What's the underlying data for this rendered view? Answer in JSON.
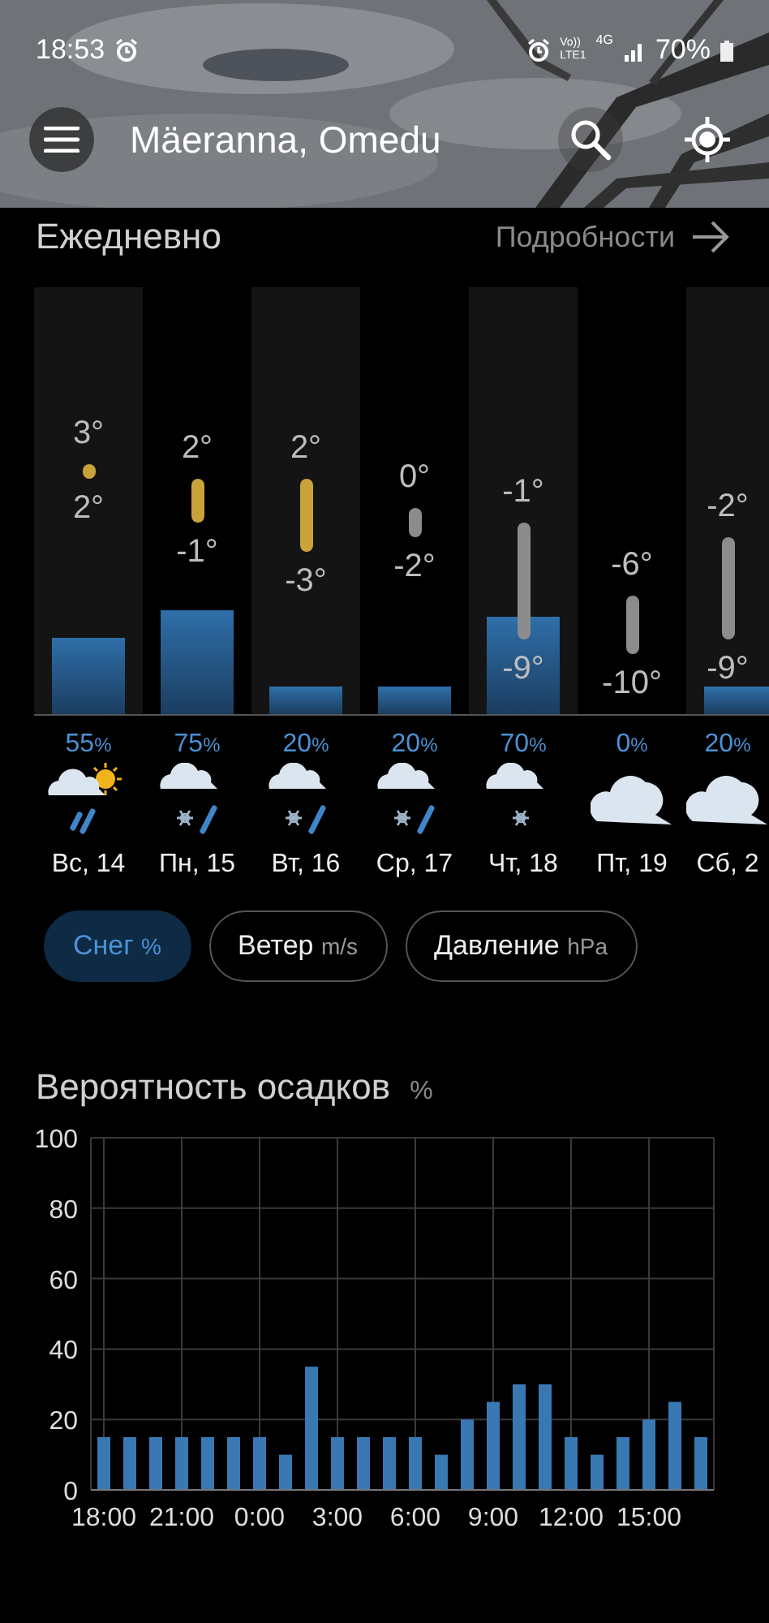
{
  "status_bar": {
    "time": "18:53",
    "volte_top": "Vo))",
    "volte_bottom": "LTE1",
    "network": "4G",
    "battery": "70%"
  },
  "header": {
    "location": "Mäeranna, Omedu"
  },
  "daily": {
    "title": "Ежедневно",
    "details_link": "Подробности",
    "days": [
      {
        "day": "Вс, 14",
        "high": "3°",
        "low": "2°",
        "color": "#c9a23a",
        "chance": "55",
        "unit": "%",
        "kind": "sunrain"
      },
      {
        "day": "Пн, 15",
        "high": "2°",
        "low": "-1°",
        "color": "#c9a23a",
        "chance": "75",
        "unit": "%",
        "kind": "sleet"
      },
      {
        "day": "Вт, 16",
        "high": "2°",
        "low": "-3°",
        "color": "#c9a23a",
        "chance": "20",
        "unit": "%",
        "kind": "sleet"
      },
      {
        "day": "Ср, 17",
        "high": "0°",
        "low": "-2°",
        "color": "#8c8c8c",
        "chance": "20",
        "unit": "%",
        "kind": "sleet"
      },
      {
        "day": "Чт, 18",
        "high": "-1°",
        "low": "-9°",
        "color": "#8c8c8c",
        "chance": "70",
        "unit": "%",
        "kind": "snow"
      },
      {
        "day": "Пт, 19",
        "high": "-6°",
        "low": "-10°",
        "color": "#8c8c8c",
        "chance": "0",
        "unit": "%",
        "kind": "overcast"
      },
      {
        "day": "Сб, 2",
        "high": "-2°",
        "low": "-9°",
        "color": "#8c8c8c",
        "chance": "20",
        "unit": "%",
        "kind": "overcast"
      }
    ]
  },
  "toggles": [
    {
      "label": "Снег",
      "unit": "%",
      "selected": true
    },
    {
      "label": "Ветер",
      "unit": "m/s",
      "selected": false
    },
    {
      "label": "Давление",
      "unit": "hPa",
      "selected": false
    }
  ],
  "precipitation": {
    "title": "Вероятность осадков",
    "unit": "%",
    "chart_data": {
      "type": "bar",
      "grid": true,
      "categories": [
        "18:00",
        null,
        null,
        "21:00",
        null,
        null,
        "0:00",
        null,
        null,
        "3:00",
        null,
        null,
        "6:00",
        null,
        null,
        "9:00",
        null,
        null,
        "12:00",
        null,
        null,
        "15:00",
        null,
        null
      ],
      "values": [
        15,
        15,
        15,
        15,
        15,
        15,
        15,
        10,
        35,
        15,
        15,
        15,
        15,
        10,
        20,
        25,
        30,
        30,
        15,
        10,
        15,
        20,
        25,
        15
      ],
      "ylim": [
        0,
        100
      ],
      "yticks": [
        0,
        20,
        40,
        60,
        80,
        100
      ]
    }
  }
}
